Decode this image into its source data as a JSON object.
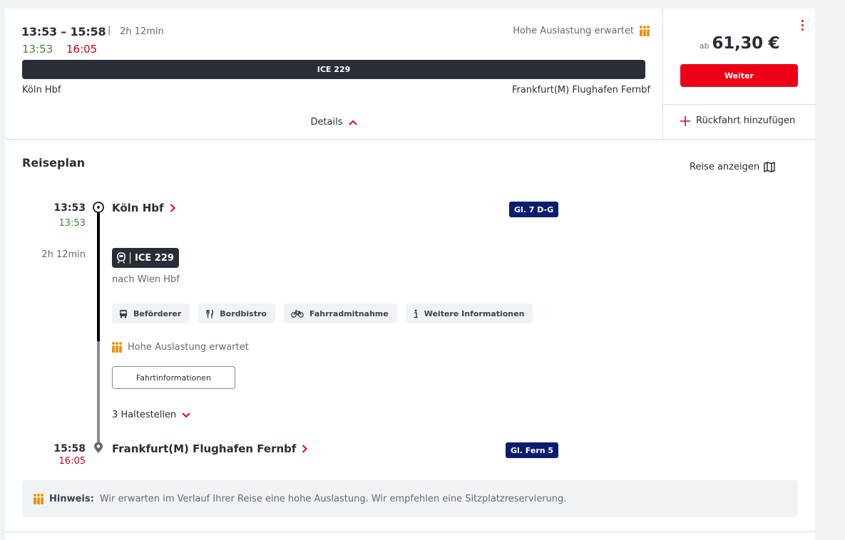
{
  "summary": {
    "times": "13:53 – 15:58",
    "separator": "|",
    "duration": "2h 12min",
    "realtime_departure": "13:53",
    "realtime_arrival": "16:05",
    "occupancy": "Hohe Auslastung erwartet",
    "train": "ICE 229",
    "from": "Köln Hbf",
    "to": "Frankfurt(M) Flughafen Fernbf",
    "details_label": "Details"
  },
  "offer": {
    "price_prefix": "ab",
    "price": "61,30 €",
    "continue_label": "Weiter",
    "return_label": "Rückfahrt hinzufügen"
  },
  "itinerary": {
    "title": "Reiseplan",
    "show_trip_label": "Reise anzeigen",
    "departure": {
      "time": "13:53",
      "realtime": "13:53",
      "station": "Köln Hbf",
      "platform": "Gl. 7 D-G"
    },
    "leg": {
      "duration": "2h 12min",
      "train": "ICE 229",
      "direction": "nach Wien Hbf",
      "chips": [
        {
          "label": "Beförderer",
          "icon": "bus-icon"
        },
        {
          "label": "Bordbistro",
          "icon": "cutlery-icon"
        },
        {
          "label": "Fahrradmitnahme",
          "icon": "bicycle-icon"
        },
        {
          "label": "Weitere Informationen",
          "icon": "info-icon"
        }
      ],
      "occupancy": "Hohe Auslastung erwartet",
      "trip_info_label": "Fahrtinformationen",
      "stops_label": "3 Haltestellen"
    },
    "arrival": {
      "time": "15:58",
      "realtime": "16:05",
      "station": "Frankfurt(M) Flughafen Fernbf",
      "platform": "Gl. Fern 5"
    }
  },
  "hint": {
    "label": "Hinweis:",
    "text": "Wir erwarten im Verlauf Ihrer Reise eine hohe Auslastung. Wir empfehlen eine Sitzplatzreservierung."
  },
  "colors": {
    "accent": "#ec0016",
    "on_time": "#408335",
    "delay": "#c50014",
    "platform": "#0a1e6e",
    "occupancy": "#f39200"
  }
}
